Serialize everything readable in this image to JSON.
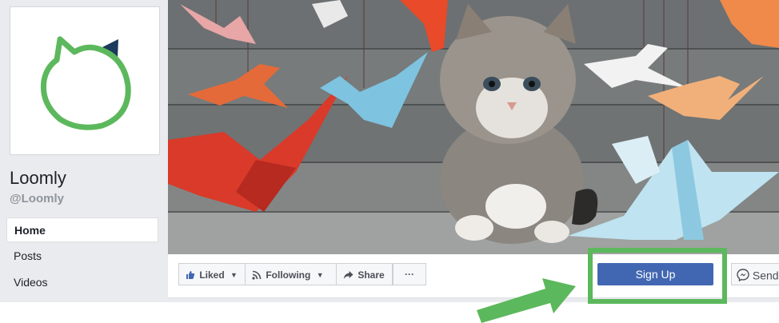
{
  "page": {
    "name": "Loomly",
    "handle": "@Loomly"
  },
  "nav": {
    "items": [
      {
        "label": "Home",
        "active": true
      },
      {
        "label": "Posts",
        "active": false
      },
      {
        "label": "Videos",
        "active": false
      }
    ]
  },
  "actions": {
    "liked": "Liked",
    "following": "Following",
    "share": "Share",
    "more": "···",
    "signup": "Sign Up",
    "send": "Send"
  },
  "colors": {
    "brand_green": "#5cb85c",
    "brand_navy": "#1b3a5c",
    "facebook_blue": "#4267b2",
    "highlight": "#5cb85c"
  },
  "icons": {
    "liked": "thumbs-up-icon",
    "following": "rss-icon",
    "share": "share-arrow-icon",
    "send": "messenger-icon"
  }
}
